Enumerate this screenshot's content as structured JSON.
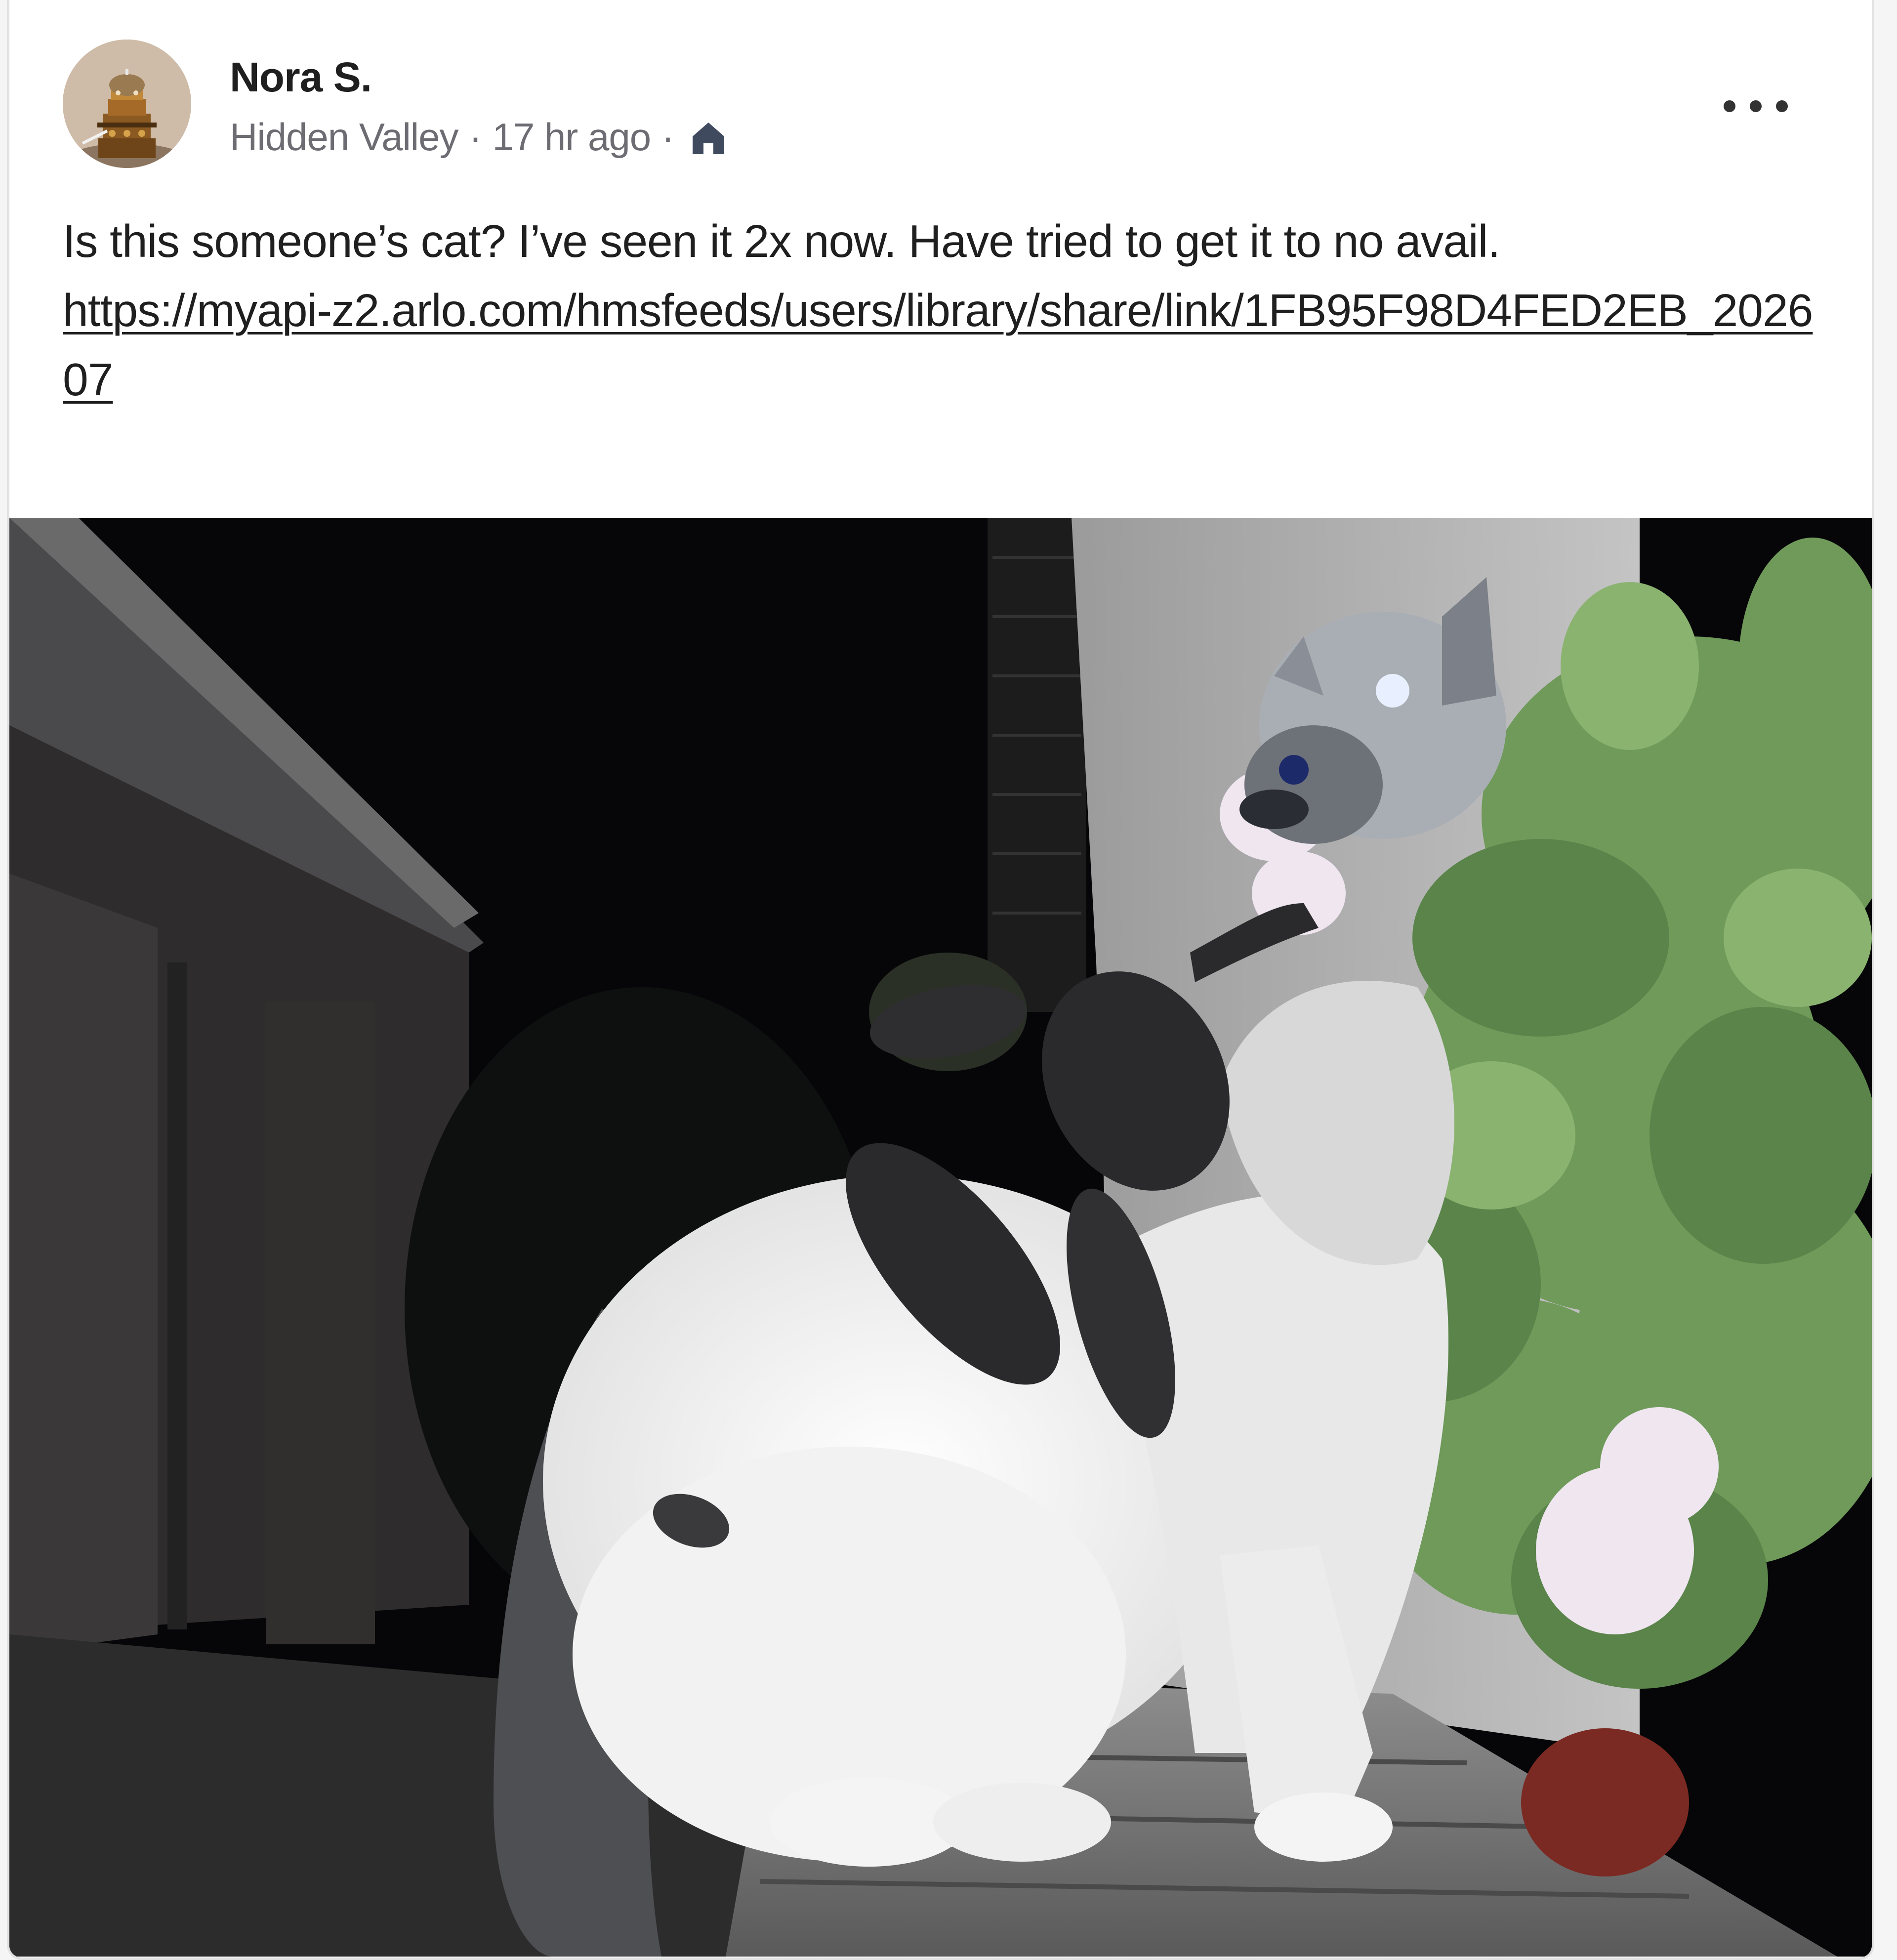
{
  "post": {
    "author_name": "Nora S.",
    "neighborhood": "Hidden Valley",
    "separator": "·",
    "time_ago": "17 hr ago",
    "audience_icon": "home-icon",
    "more_icon": "more-horizontal-icon",
    "body_text": "Is this someone’s cat?  I’ve seen it 2x now.  Have tried to get it to no avail.",
    "link_text": "https://myapi-z2.arlo.com/hmsfeeds/users/library/share/link/1FB95F98D4FED2EB_202607",
    "photo_subject": "photo"
  },
  "colors": {
    "text_primary": "#1f1f1f",
    "text_secondary": "#6c6c72",
    "home_icon": "#3f4a5e",
    "card_border": "#e2e2e2"
  }
}
